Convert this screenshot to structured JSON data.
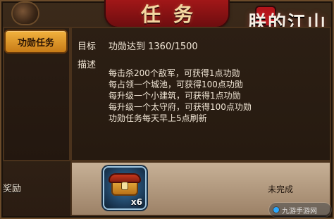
{
  "window": {
    "title": "任务",
    "game_logo": "朕的江山"
  },
  "tabs": [
    {
      "label": "功勋任务",
      "active": true
    }
  ],
  "task": {
    "goal_label": "目标",
    "goal_value": "功勋达到 1360/1500",
    "description_label": "描述",
    "description_lines": [
      "每击杀200个敌军，可获得1点功勋",
      "每占领一个城池，可获得100点功勋",
      "每升级一个小建筑，可获得1点功勋",
      "每升级一个太守府，可获得100点功勋",
      "功勋任务每天早上5点刷新"
    ]
  },
  "reward": {
    "label": "奖励",
    "item": {
      "icon": "treasure-chest-icon",
      "quantity": "x6"
    },
    "status": "未完成"
  },
  "watermark": {
    "text": "九游手游网"
  },
  "colors": {
    "title_banner": "#a11718",
    "tab_active": "#f2b23e",
    "reward_slot": "#3a76a4"
  }
}
